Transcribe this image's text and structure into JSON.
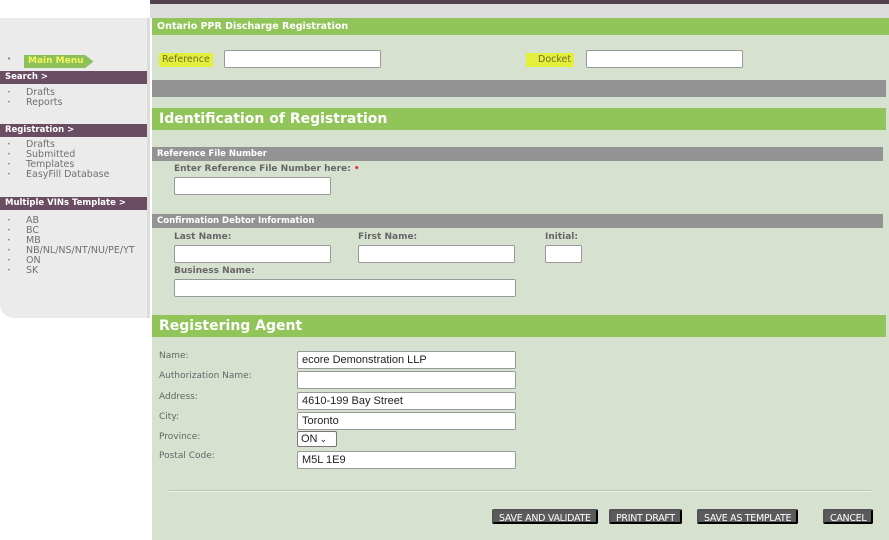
{
  "sidebar": {
    "main_menu": "Main Menu",
    "sections": [
      {
        "header": "Search >",
        "items": [
          "Drafts",
          "Reports"
        ]
      },
      {
        "header": "Registration >",
        "items": [
          "Drafts",
          "Submitted",
          "Templates",
          "EasyFill Database"
        ]
      },
      {
        "header": "Multiple VINs Template >",
        "items": [
          "AB",
          "BC",
          "MB",
          "NB/NL/NS/NT/NU/PE/YT",
          "ON",
          "SK"
        ]
      }
    ]
  },
  "header": {
    "title": "Ontario PPR Discharge Registration",
    "reference_label": "Reference",
    "reference_value": "",
    "docket_label": "Docket",
    "docket_value": ""
  },
  "identification": {
    "title": "Identification of Registration",
    "ref_file_header": "Reference File Number",
    "ref_file_label": "Enter Reference File Number here:",
    "required_marker": "•",
    "ref_file_value": "",
    "debtor_header": "Confirmation Debtor Information",
    "last_name_label": "Last Name:",
    "first_name_label": "First Name:",
    "initial_label": "Initial:",
    "business_name_label": "Business Name:",
    "last_name_value": "",
    "first_name_value": "",
    "initial_value": "",
    "business_name_value": ""
  },
  "agent": {
    "title": "Registering Agent",
    "fields": [
      {
        "label": "Name:",
        "value": "ecore Demonstration LLP"
      },
      {
        "label": "Authorization Name:",
        "value": ""
      },
      {
        "label": "Address:",
        "value": "4610-199 Bay Street"
      },
      {
        "label": "City:",
        "value": "Toronto"
      },
      {
        "label": "Province:",
        "value": "ON"
      },
      {
        "label": "Postal Code:",
        "value": "M5L 1E9"
      }
    ]
  },
  "actions": {
    "save_validate": "SAVE AND VALIDATE",
    "print_draft": "PRINT DRAFT",
    "save_template": "SAVE AS TEMPLATE",
    "cancel": "CANCEL"
  },
  "colors": {
    "green": "#91c459",
    "purple": "#6a4d63",
    "highlight": "#e4ef3b",
    "panel": "#d7e1cf"
  }
}
